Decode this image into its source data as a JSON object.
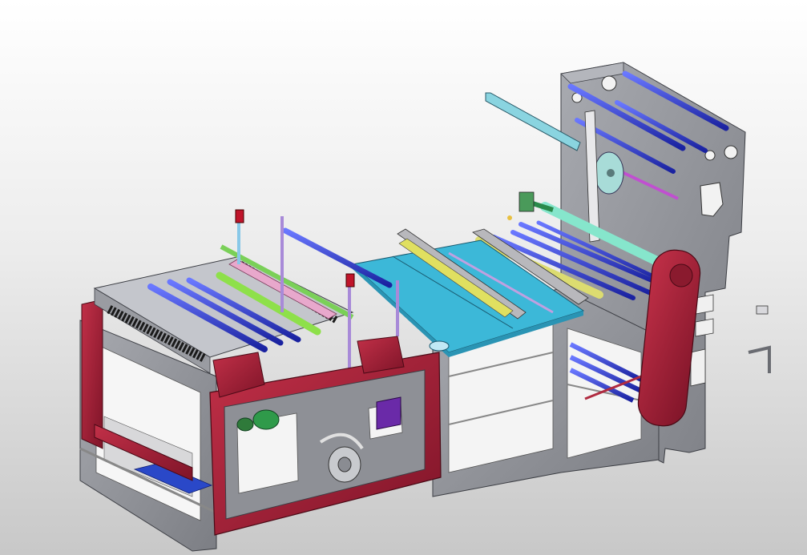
{
  "viewport": {
    "background_top": "#ffffff",
    "background_bottom": "#c6c6c6"
  },
  "model": {
    "frame_color": "#8e9096",
    "frame_dark": "#6c6e74",
    "guard_red": "#a3213a",
    "roller_blue": "#2a3cd2",
    "tray_cyan": "#39b6d6",
    "roller_green": "#8ee04a",
    "roller_pink": "#e8a0c8",
    "roller_yellow": "#d8d86a",
    "roller_aqua": "#7fe0c8",
    "gear_green": "#2f9a4a",
    "gear_purple": "#6a2aa8",
    "button_red": "#c0142a"
  }
}
